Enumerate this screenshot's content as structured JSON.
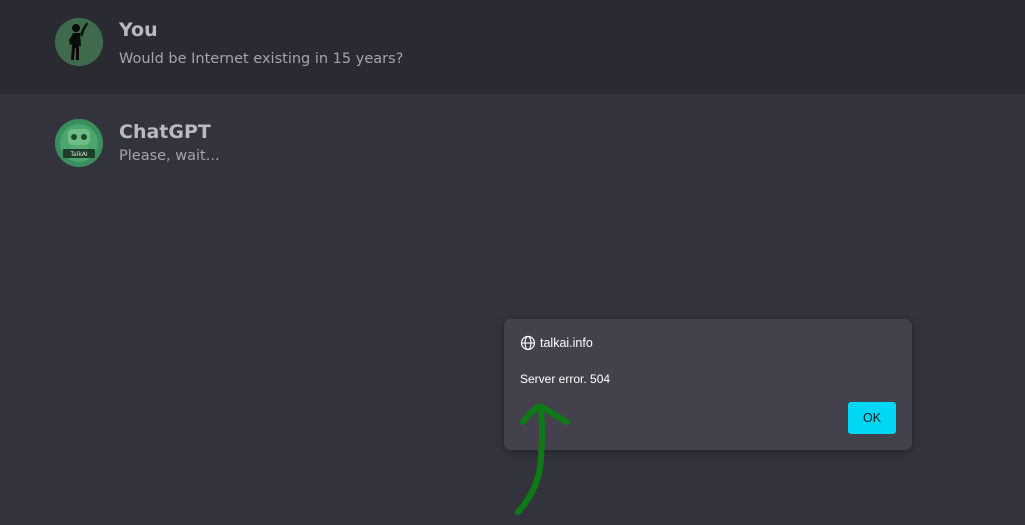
{
  "conversation": {
    "user_message": {
      "author": "You",
      "text": "Would be Internet existing in 15 years?",
      "avatar": "person-silhouette-icon"
    },
    "bot_message": {
      "author": "ChatGPT",
      "text": "Please, wait...",
      "avatar": "talkai-robot-icon",
      "avatar_label": "TalkAI"
    }
  },
  "dialog": {
    "origin": "talkai.info",
    "origin_icon": "globe-icon",
    "message": "Server error. 504",
    "ok_label": "OK"
  },
  "annotation": {
    "icon": "arrow-up-icon",
    "color": "#0d7a16"
  },
  "colors": {
    "background": "#33333d",
    "user_row": "#2a2a33",
    "dialog_bg": "#43414c",
    "ok_button": "#00d7f5"
  }
}
